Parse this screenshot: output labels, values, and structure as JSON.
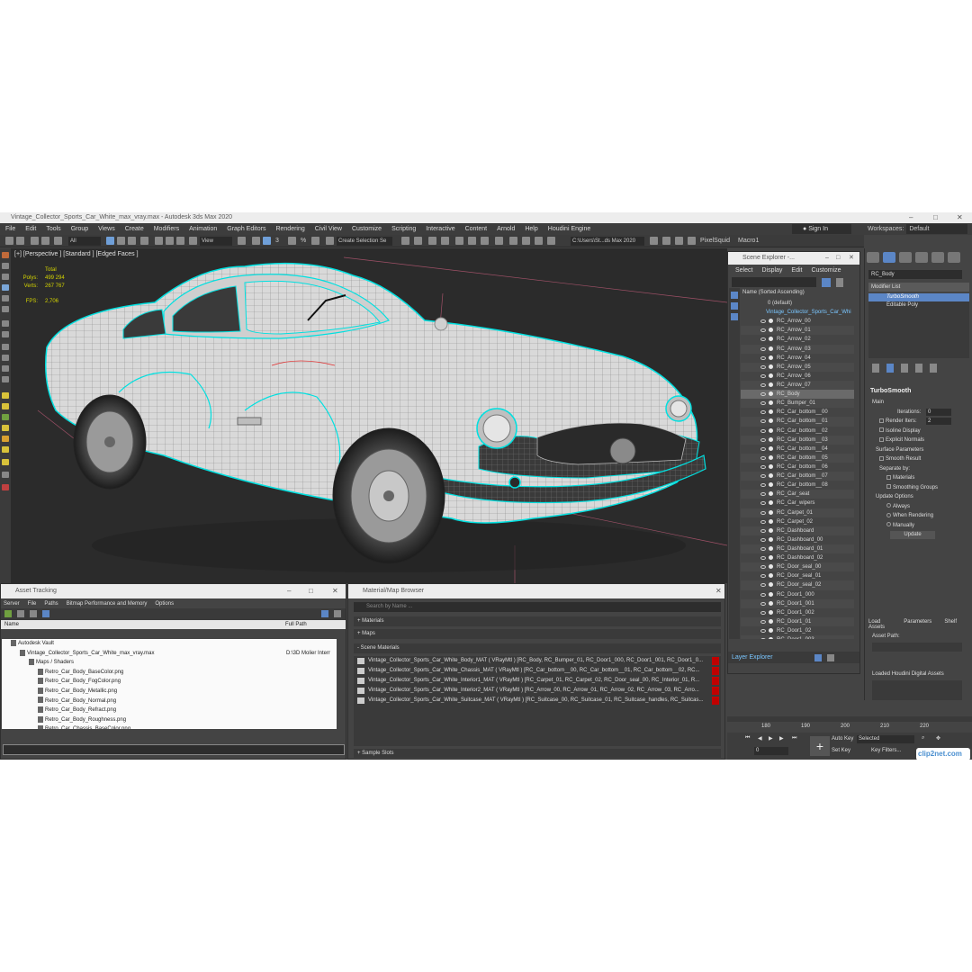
{
  "window": {
    "title": "Vintage_Collector_Sports_Car_White_max_vray.max - Autodesk 3ds Max 2020"
  },
  "menu": [
    "File",
    "Edit",
    "Tools",
    "Group",
    "Views",
    "Create",
    "Modifiers",
    "Animation",
    "Graph Editors",
    "Rendering",
    "Civil View",
    "Customize",
    "Scripting",
    "Interactive",
    "Content",
    "Arnold",
    "Help",
    "Houdini Engine"
  ],
  "account": {
    "sign_in": "Sign In",
    "workspaces_label": "Workspaces:",
    "workspace_value": "Default"
  },
  "toolbar": {
    "filter": "All",
    "ref_coord": "View",
    "selection_set": "Create Selection Se",
    "path": "C:\\Users\\St...ds Max 2020",
    "pixelsquid": "PixelSquid",
    "macro": "Macro1",
    "angle_snap": "3",
    "percent": "%"
  },
  "viewport": {
    "label": "[+] [Perspective ] [Standard ] [Edged Faces ]",
    "stats": {
      "total_label": "Total",
      "polys_label": "Polys:",
      "polys": "499 294",
      "verts_label": "Verts:",
      "verts": "267 767",
      "fps_label": "FPS:",
      "fps": "2,706"
    }
  },
  "scene_explorer": {
    "title": "Scene Explorer -...",
    "menu": [
      "Select",
      "Display",
      "Edit",
      "Customize"
    ],
    "column": "Name (Sorted Ascending)",
    "root_default": "0 (default)",
    "root_file": "Vintage_Collector_Sports_Car_Whi",
    "items": [
      "RC_Arrow_00",
      "RC_Arrow_01",
      "RC_Arrow_02",
      "RC_Arrow_03",
      "RC_Arrow_04",
      "RC_Arrow_05",
      "RC_Arrow_06",
      "RC_Arrow_07",
      "RC_Body",
      "RC_Bumper_01",
      "RC_Car_bottom__00",
      "RC_Car_bottom__01",
      "RC_Car_bottom__02",
      "RC_Car_bottom__03",
      "RC_Car_bottom__04",
      "RC_Car_bottom__05",
      "RC_Car_bottom__06",
      "RC_Car_bottom__07",
      "RC_Car_bottom__08",
      "RC_Car_seat",
      "RC_Car_wipers",
      "RC_Carpet_01",
      "RC_Carpet_02",
      "RC_Dashboard",
      "RC_Dashboard_00",
      "RC_Dashboard_01",
      "RC_Dashboard_02",
      "RC_Door_seal_00",
      "RC_Door_seal_01",
      "RC_Door_seal_02",
      "RC_Door1_000",
      "RC_Door1_001",
      "RC_Door1_002",
      "RC_Door1_01",
      "RC_Door1_02",
      "RC_Door1_003",
      "RC_Door1_03"
    ],
    "selected_index": 8,
    "footer": "Layer Explorer"
  },
  "command_panel": {
    "object_name": "RC_Body",
    "modifier_list": "Modifier List",
    "stack": [
      "TurboSmooth",
      "Editable Poly"
    ],
    "turbosmooth": {
      "title": "TurboSmooth",
      "main": "Main",
      "iterations_label": "Iterations:",
      "iterations": "0",
      "render_iters_label": "Render Iters:",
      "render_iters": "2",
      "isoline": "Isoline Display",
      "explicit": "Explicit Normals",
      "surface": "Surface Parameters",
      "smooth_result": "Smooth Result",
      "separate": "Separate by:",
      "materials": "Materials",
      "smoothing_groups": "Smoothing Groups",
      "update_options": "Update Options",
      "always": "Always",
      "when_rendering": "When Rendering",
      "manually": "Manually",
      "update_btn": "Update"
    },
    "houdini_tabs": [
      "Load Assets",
      "Parameters",
      "Shelf"
    ],
    "asset_path": "Asset Path:",
    "loaded_assets": "Loaded Houdini Digital Assets"
  },
  "asset_tracking": {
    "title": "Asset Tracking",
    "menu": [
      "Server",
      "File",
      "Paths",
      "Bitmap Performance and Memory",
      "Options"
    ],
    "col_name": "Name",
    "col_path": "Full Path",
    "rows": [
      {
        "indent": 0,
        "name": "Autodesk Vault",
        "path": ""
      },
      {
        "indent": 1,
        "name": "Vintage_Collector_Sports_Car_White_max_vray.max",
        "path": "D:\\3D Molier Interr"
      },
      {
        "indent": 2,
        "name": "Maps / Shaders",
        "path": ""
      },
      {
        "indent": 3,
        "name": "Retro_Car_Body_BaseColor.png",
        "path": ""
      },
      {
        "indent": 3,
        "name": "Retro_Car_Body_FogColor.png",
        "path": ""
      },
      {
        "indent": 3,
        "name": "Retro_Car_Body_Metallic.png",
        "path": ""
      },
      {
        "indent": 3,
        "name": "Retro_Car_Body_Normal.png",
        "path": ""
      },
      {
        "indent": 3,
        "name": "Retro_Car_Body_Refract.png",
        "path": ""
      },
      {
        "indent": 3,
        "name": "Retro_Car_Body_Roughness.png",
        "path": ""
      },
      {
        "indent": 3,
        "name": "Retro_Car_Chassis_BaseColor.png",
        "path": ""
      }
    ]
  },
  "material_browser": {
    "title": "Material/Map Browser",
    "search": "Search by Name ...",
    "materials": "+ Materials",
    "maps": "+ Maps",
    "scene_materials": "- Scene Materials",
    "sample_slots": "+ Sample Slots",
    "rows": [
      "Vintage_Collector_Sports_Car_White_Body_MAT ( VRayMtl ) [RC_Body, RC_Bumper_01, RC_Door1_000, RC_Door1_001, RC_Door1_0...",
      "Vintage_Collector_Sports_Car_White_Chassis_MAT ( VRayMtl ) [RC_Car_bottom__00, RC_Car_bottom__01, RC_Car_bottom__02, RC...",
      "Vintage_Collector_Sports_Car_White_Interior1_MAT ( VRayMtl ) [RC_Carpet_01, RC_Carpet_02, RC_Door_seal_00, RC_Interior_01, R...",
      "Vintage_Collector_Sports_Car_White_Interior2_MAT ( VRayMtl ) [RC_Arrow_00, RC_Arrow_01, RC_Arrow_02, RC_Arrow_03, RC_Arro...",
      "Vintage_Collector_Sports_Car_White_Suitcase_MAT ( VRayMtl ) [RC_Suitcase_00, RC_Suitcase_01, RC_Suitcase_handles, RC_Suitcas..."
    ]
  },
  "timeline": {
    "ticks": [
      "180",
      "190",
      "200",
      "210",
      "220"
    ],
    "frame": "0",
    "auto_key": "Auto Key",
    "selected": "Selected",
    "set_key": "Set Key",
    "key_filters": "Key Filters..."
  },
  "watermark": "clip2net.com",
  "colors": {
    "wire_highlight": "#00e0e0",
    "selection_red": "#c00000",
    "accent_blue": "#5b86c6"
  }
}
